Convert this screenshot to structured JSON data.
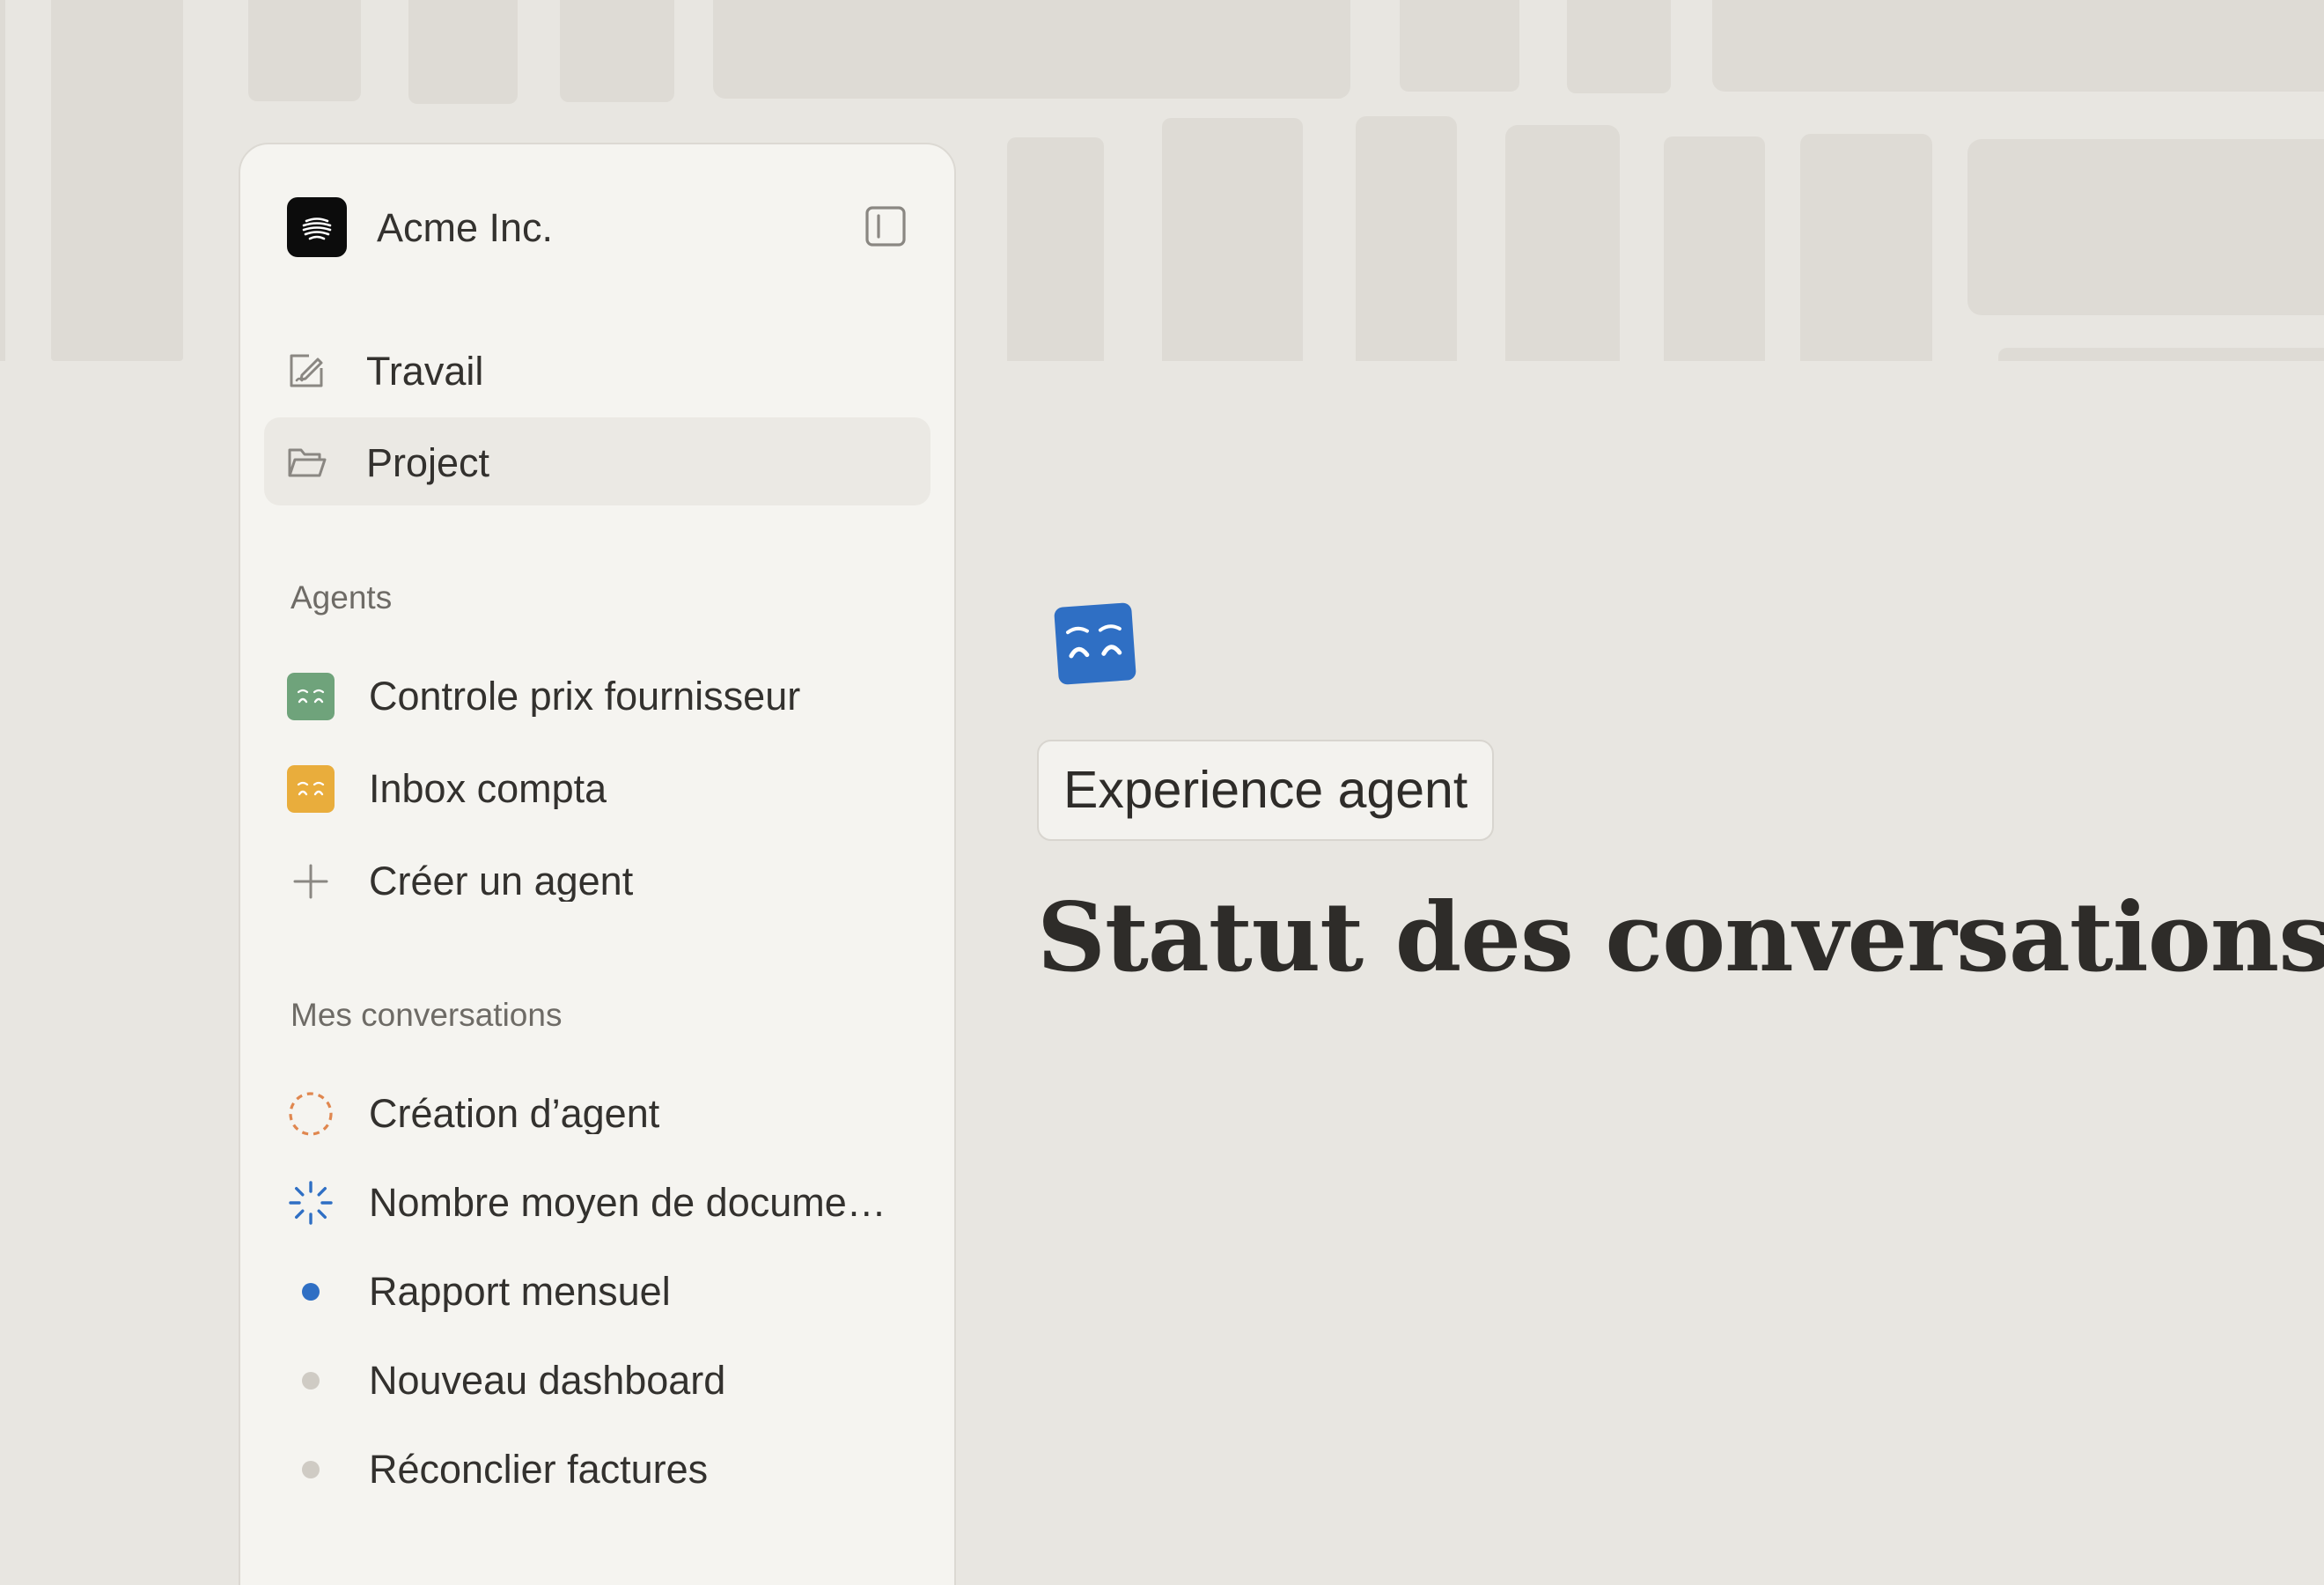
{
  "workspace": {
    "name": "Acme Inc."
  },
  "nav": [
    {
      "label": "Travail",
      "icon": "edit-note-icon",
      "active": false
    },
    {
      "label": "Project",
      "icon": "folder-icon",
      "active": true
    }
  ],
  "agents": {
    "title": "Agents",
    "items": [
      {
        "label": "Controle prix fournisseur",
        "color": "#6fa37b"
      },
      {
        "label": "Inbox compta",
        "color": "#e9ad3c"
      }
    ],
    "create_label": "Créer un agent"
  },
  "conversations": {
    "title": "Mes conversations",
    "items": [
      {
        "label": "Création d’agent",
        "status": "draft",
        "color": "#e0874f"
      },
      {
        "label": "Nombre moyen de docume…",
        "status": "loading",
        "color": "#2f6fc4"
      },
      {
        "label": "Rapport mensuel",
        "status": "active",
        "color": "#2f6fc4"
      },
      {
        "label": "Nouveau dashboard",
        "status": "idle",
        "color": "#cfcbc4"
      },
      {
        "label": "Réconclier factures",
        "status": "idle",
        "color": "#cfcbc4"
      }
    ]
  },
  "main": {
    "icon": "agent-face-icon",
    "icon_color": "#2f6fc4",
    "tag": "Experience agent",
    "title": "Statut des conversations"
  },
  "colors": {
    "background": "#e8e6e1",
    "sidebar": "#f5f4f0",
    "active_item": "#ebe9e4"
  }
}
